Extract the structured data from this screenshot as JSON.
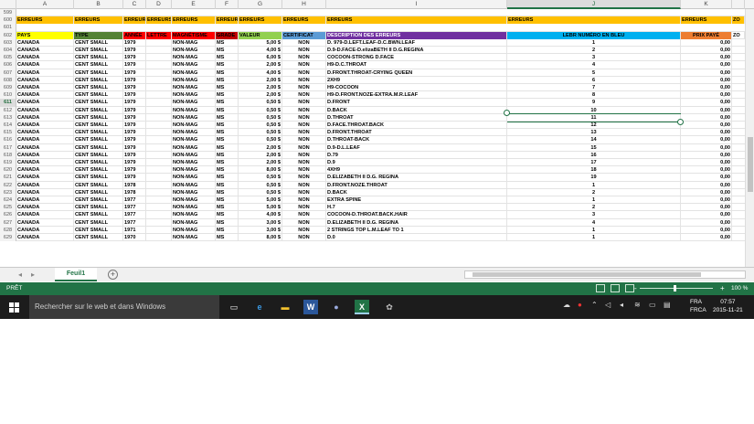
{
  "columns": [
    "A",
    "B",
    "C",
    "D",
    "E",
    "F",
    "G",
    "H",
    "I",
    "J",
    "K"
  ],
  "selected_column": "J",
  "header_rows": {
    "r599": {
      "num": "599"
    },
    "r600": {
      "num": "600",
      "cells": [
        "ERREURS",
        "ERREURS",
        "ERREURS",
        "ERREURS",
        "ERREURS",
        "ERREURS",
        "ERREURS",
        "ERREURS",
        "ERREURS",
        "ERREURS",
        "ERREURS",
        "ZO"
      ]
    },
    "r601": {
      "num": "601"
    },
    "r602": {
      "num": "602",
      "pays": "PAYS",
      "type": "TYPE",
      "annee": "ANNÉE",
      "lettre": "LETTRE",
      "magnetisme": "MAGNÉTISME",
      "grade": "GRADE",
      "valeur": "VALEUR",
      "certificat": "CERTIFICAT",
      "description": "DESCRIPTION DES ERREURS",
      "lebr": "LEBR NUMÉRO EN BLEU",
      "prix": "PRIX PAYÉ",
      "zo": "ZO"
    }
  },
  "rows": [
    {
      "num": "603",
      "pays": "CANADA",
      "type": "CENT SMALL",
      "annee": "1979",
      "mag": "NON-MAG",
      "grade": "MS",
      "valeur": "5,00 $",
      "cert": "NON",
      "desc": "D. 979-D.LEFT.LEAF-D.C.BWN.LEAF",
      "lebr": "1",
      "prix": "0,00"
    },
    {
      "num": "604",
      "pays": "CANADA",
      "type": "CENT SMALL",
      "annee": "1979",
      "mag": "NON-MAG",
      "grade": "MS",
      "valeur": "4,00 $",
      "cert": "NON",
      "desc": "D.9-D.FACE-D.elizaBETH II D.G.REGINA",
      "lebr": "2",
      "prix": "0,00"
    },
    {
      "num": "605",
      "pays": "CANADA",
      "type": "CENT SMALL",
      "annee": "1979",
      "mag": "NON-MAG",
      "grade": "MS",
      "valeur": "6,00 $",
      "cert": "NON",
      "desc": "COCOON-STRONG D.FACE",
      "lebr": "3",
      "prix": "0,00"
    },
    {
      "num": "606",
      "pays": "CANADA",
      "type": "CENT SMALL",
      "annee": "1979",
      "mag": "NON-MAG",
      "grade": "MS",
      "valeur": "2,00 $",
      "cert": "NON",
      "desc": "H9-D.C.THROAT",
      "lebr": "4",
      "prix": "0,00"
    },
    {
      "num": "607",
      "pays": "CANADA",
      "type": "CENT SMALL",
      "annee": "1979",
      "mag": "NON-MAG",
      "grade": "MS",
      "valeur": "4,00 $",
      "cert": "NON",
      "desc": "D.FRONT.THROAT-CRYING QUEEN",
      "lebr": "5",
      "prix": "0,00"
    },
    {
      "num": "608",
      "pays": "CANADA",
      "type": "CENT SMALL",
      "annee": "1979",
      "mag": "NON-MAG",
      "grade": "MS",
      "valeur": "2,00 $",
      "cert": "NON",
      "desc": "2XH9",
      "lebr": "6",
      "prix": "0,00"
    },
    {
      "num": "609",
      "pays": "CANADA",
      "type": "CENT SMALL",
      "annee": "1979",
      "mag": "NON-MAG",
      "grade": "MS",
      "valeur": "2,00 $",
      "cert": "NON",
      "desc": "H9-COCOON",
      "lebr": "7",
      "prix": "0,00"
    },
    {
      "num": "610",
      "pays": "CANADA",
      "type": "CENT SMALL",
      "annee": "1979",
      "mag": "NON-MAG",
      "grade": "MS",
      "valeur": "2,00 $",
      "cert": "NON",
      "desc": "H9-D.FRONT.NOZE-EXTRA.M.R.LEAF",
      "lebr": "8",
      "prix": "0,00"
    },
    {
      "num": "611",
      "pays": "CANADA",
      "type": "CENT SMALL",
      "annee": "1979",
      "mag": "NON-MAG",
      "grade": "MS",
      "valeur": "0,50 $",
      "cert": "NON",
      "desc": "D.FRONT",
      "lebr": "9",
      "prix": "0,00"
    },
    {
      "num": "612",
      "pays": "CANADA",
      "type": "CENT SMALL",
      "annee": "1979",
      "mag": "NON-MAG",
      "grade": "MS",
      "valeur": "0,50 $",
      "cert": "NON",
      "desc": "D.BACK",
      "lebr": "10",
      "prix": "0,00"
    },
    {
      "num": "613",
      "pays": "CANADA",
      "type": "CENT SMALL",
      "annee": "1979",
      "mag": "NON-MAG",
      "grade": "MS",
      "valeur": "0,50 $",
      "cert": "NON",
      "desc": "D.THROAT",
      "lebr": "11",
      "prix": "0,00"
    },
    {
      "num": "614",
      "pays": "CANADA",
      "type": "CENT SMALL",
      "annee": "1979",
      "mag": "NON-MAG",
      "grade": "MS",
      "valeur": "0,50 $",
      "cert": "NON",
      "desc": "D.FACE.THROAT.BACK",
      "lebr": "12",
      "prix": "0,00"
    },
    {
      "num": "615",
      "pays": "CANADA",
      "type": "CENT SMALL",
      "annee": "1979",
      "mag": "NON-MAG",
      "grade": "MS",
      "valeur": "0,50 $",
      "cert": "NON",
      "desc": "D.FRONT.THROAT",
      "lebr": "13",
      "prix": "0,00"
    },
    {
      "num": "616",
      "pays": "CANADA",
      "type": "CENT SMALL",
      "annee": "1979",
      "mag": "NON-MAG",
      "grade": "MS",
      "valeur": "0,50 $",
      "cert": "NON",
      "desc": "D.THROAT-BACK",
      "lebr": "14",
      "prix": "0,00"
    },
    {
      "num": "617",
      "pays": "CANADA",
      "type": "CENT SMALL",
      "annee": "1979",
      "mag": "NON-MAG",
      "grade": "MS",
      "valeur": "2,00 $",
      "cert": "NON",
      "desc": "D.9-D.L.LEAF",
      "lebr": "15",
      "prix": "0,00"
    },
    {
      "num": "618",
      "pays": "CANADA",
      "type": "CENT SMALL",
      "annee": "1979",
      "mag": "NON-MAG",
      "grade": "MS",
      "valeur": "2,00 $",
      "cert": "NON",
      "desc": "D.79",
      "lebr": "16",
      "prix": "0,00"
    },
    {
      "num": "619",
      "pays": "CANADA",
      "type": "CENT SMALL",
      "annee": "1979",
      "mag": "NON-MAG",
      "grade": "MS",
      "valeur": "2,00 $",
      "cert": "NON",
      "desc": "D.9",
      "lebr": "17",
      "prix": "0,00"
    },
    {
      "num": "620",
      "pays": "CANADA",
      "type": "CENT SMALL",
      "annee": "1979",
      "mag": "NON-MAG",
      "grade": "MS",
      "valeur": "8,00 $",
      "cert": "NON",
      "desc": "4XH9",
      "lebr": "18",
      "prix": "0,00"
    },
    {
      "num": "621",
      "pays": "CANADA",
      "type": "CENT SMALL",
      "annee": "1979",
      "mag": "NON-MAG",
      "grade": "MS",
      "valeur": "0,50 $",
      "cert": "NON",
      "desc": "D.ELIZABETH II D.G. REGINA",
      "lebr": "19",
      "prix": "0,00"
    },
    {
      "num": "622",
      "pays": "CANADA",
      "type": "CENT SMALL",
      "annee": "1978",
      "mag": "NON-MAG",
      "grade": "MS",
      "valeur": "0,50 $",
      "cert": "NON",
      "desc": "D.FRONT.NOZE.THROAT",
      "lebr": "1",
      "prix": "0,00"
    },
    {
      "num": "623",
      "pays": "CANADA",
      "type": "CENT SMALL",
      "annee": "1978",
      "mag": "NON-MAG",
      "grade": "MS",
      "valeur": "0,50 $",
      "cert": "NON",
      "desc": "D.BACK",
      "lebr": "2",
      "prix": "0,00"
    },
    {
      "num": "624",
      "pays": "CANADA",
      "type": "CENT SMALL",
      "annee": "1977",
      "mag": "NON-MAG",
      "grade": "MS",
      "valeur": "5,00 $",
      "cert": "NON",
      "desc": "EXTRA SPINE",
      "lebr": "1",
      "prix": "0,00"
    },
    {
      "num": "625",
      "pays": "CANADA",
      "type": "CENT SMALL",
      "annee": "1977",
      "mag": "NON-MAG",
      "grade": "MS",
      "valeur": "5,00 $",
      "cert": "NON",
      "desc": "H.7",
      "lebr": "2",
      "prix": "0,00"
    },
    {
      "num": "626",
      "pays": "CANADA",
      "type": "CENT SMALL",
      "annee": "1977",
      "mag": "NON-MAG",
      "grade": "MS",
      "valeur": "4,00 $",
      "cert": "NON",
      "desc": "COCOON-D.THROAT.BACK.HAIR",
      "lebr": "3",
      "prix": "0,00"
    },
    {
      "num": "627",
      "pays": "CANADA",
      "type": "CENT SMALL",
      "annee": "1977",
      "mag": "NON-MAG",
      "grade": "MS",
      "valeur": "3,00 $",
      "cert": "NON",
      "desc": "D.ELIZABETH II D.G. REGINA",
      "lebr": "4",
      "prix": "0,00"
    },
    {
      "num": "628",
      "pays": "CANADA",
      "type": "CENT SMALL",
      "annee": "1971",
      "mag": "NON-MAG",
      "grade": "MS",
      "valeur": "3,00 $",
      "cert": "NON",
      "desc": "2 STRINGS TOP L.M.LEAF TO 1",
      "lebr": "1",
      "prix": "0,00"
    },
    {
      "num": "629",
      "pays": "CANADA",
      "type": "CENT SMALL",
      "annee": "1970",
      "mag": "NON-MAG",
      "grade": "MS",
      "valeur": "8,00 $",
      "cert": "NON",
      "desc": "D.0",
      "lebr": "1",
      "prix": "0,00"
    }
  ],
  "sheet_tab": {
    "label": "Feuil1",
    "add": "+"
  },
  "status": {
    "ready": "PRÊT",
    "zoom": "100 %",
    "minus": "-",
    "plus": "+"
  },
  "taskbar": {
    "search_placeholder": "Rechercher sur le web et dans Windows",
    "lang_top": "FRA",
    "lang_bottom": "FRCA",
    "time": "07:57",
    "date": "2015-11-21"
  },
  "colors": {
    "accent": "#217346",
    "taskbar": "#1c1c1c",
    "errors_band": "#ffc000"
  }
}
